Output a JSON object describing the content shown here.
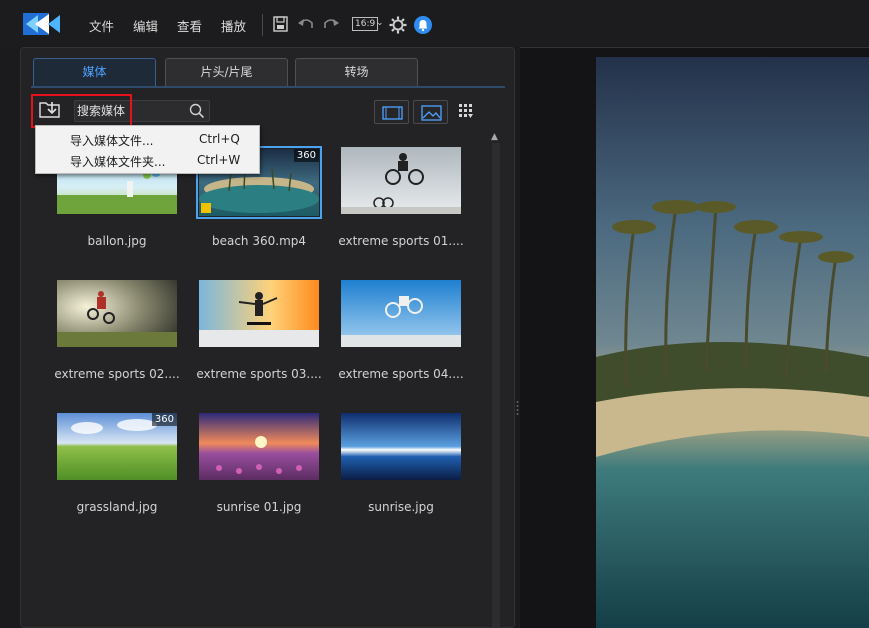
{
  "menu": {
    "file": "文件",
    "edit": "编辑",
    "view": "查看",
    "play": "播放"
  },
  "toolbar": {
    "aspect_ratio": "16:9"
  },
  "tabs": [
    {
      "label": "媒体",
      "active": true
    },
    {
      "label": "片头/片尾",
      "active": false
    },
    {
      "label": "转场",
      "active": false
    }
  ],
  "search": {
    "placeholder": "搜索媒体"
  },
  "import_menu": {
    "items": [
      {
        "label": "导入媒体文件...",
        "shortcut": "Ctrl+Q"
      },
      {
        "label": "导入媒体文件夹...",
        "shortcut": "Ctrl+W"
      }
    ]
  },
  "media": [
    {
      "name": "ballon.jpg",
      "badge": ""
    },
    {
      "name": "beach 360.mp4",
      "badge": "360",
      "selected": true
    },
    {
      "name": "extreme sports 01....",
      "badge": ""
    },
    {
      "name": "extreme sports 02....",
      "badge": ""
    },
    {
      "name": "extreme sports 03....",
      "badge": ""
    },
    {
      "name": "extreme sports 04....",
      "badge": ""
    },
    {
      "name": "grassland.jpg",
      "badge": "360"
    },
    {
      "name": "sunrise 01.jpg",
      "badge": ""
    },
    {
      "name": "sunrise.jpg",
      "badge": ""
    }
  ],
  "colors": {
    "accent": "#4ea3ff",
    "highlight": "#e8101a",
    "bell": "#2f8cf0"
  }
}
